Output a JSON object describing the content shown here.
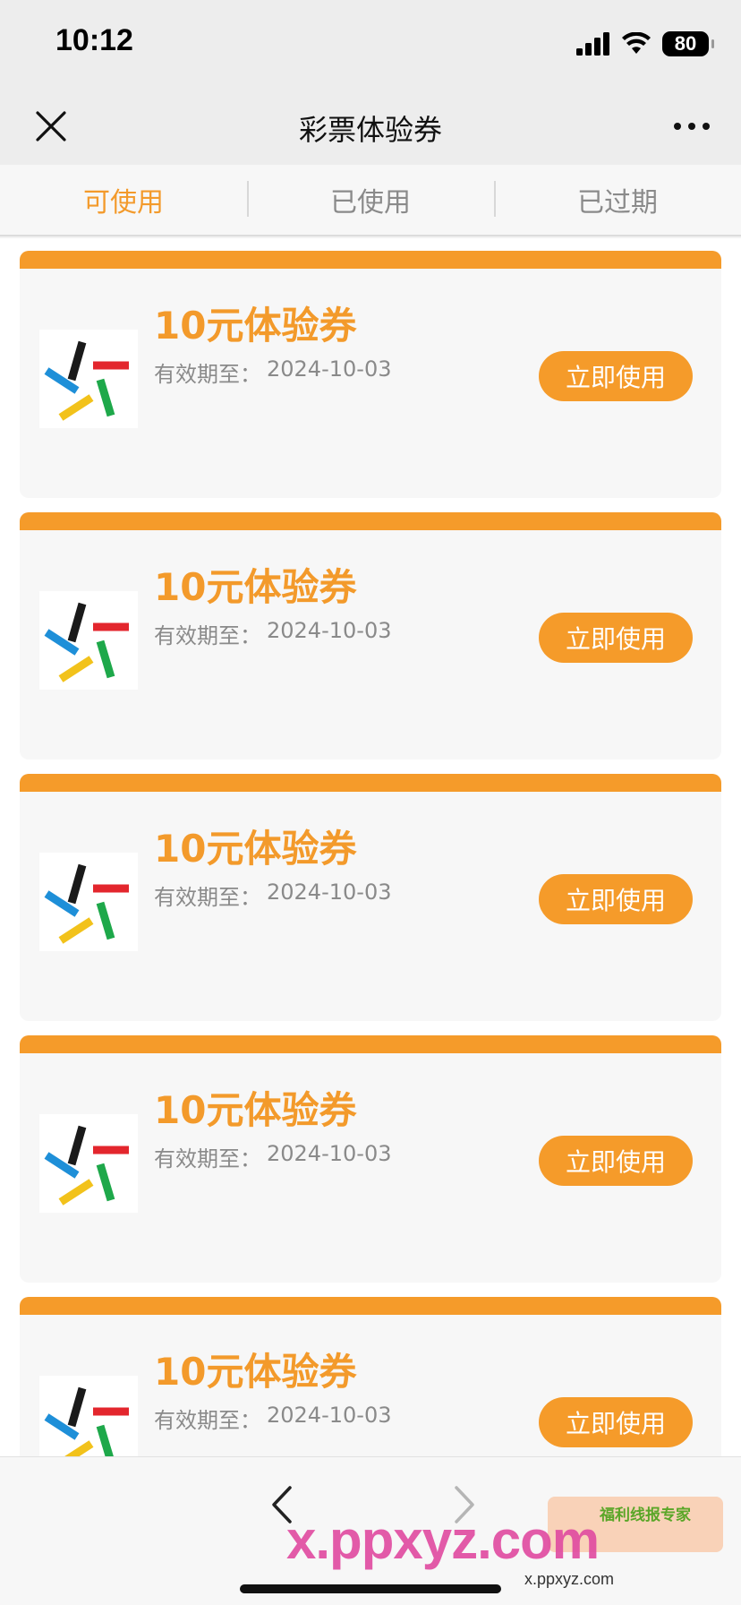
{
  "status": {
    "time": "10:12",
    "battery": "80"
  },
  "nav": {
    "title": "彩票体验券"
  },
  "tabs": [
    {
      "label": "可使用",
      "active": true
    },
    {
      "label": "已使用",
      "active": false
    },
    {
      "label": "已过期",
      "active": false
    }
  ],
  "coupons": [
    {
      "title": "10元体验券",
      "expiry_label": "有效期至：",
      "expiry_date": "2024-10-03",
      "button": "立即使用"
    },
    {
      "title": "10元体验券",
      "expiry_label": "有效期至：",
      "expiry_date": "2024-10-03",
      "button": "立即使用"
    },
    {
      "title": "10元体验券",
      "expiry_label": "有效期至：",
      "expiry_date": "2024-10-03",
      "button": "立即使用"
    },
    {
      "title": "10元体验券",
      "expiry_label": "有效期至：",
      "expiry_date": "2024-10-03",
      "button": "立即使用"
    },
    {
      "title": "10元体验券",
      "expiry_label": "有效期至：",
      "expiry_date": "2024-10-03",
      "button": "立即使用"
    }
  ],
  "watermark": {
    "text": "x.ppxyz.com",
    "sub": "x.ppxyz.com",
    "badge": "福利线报专家"
  },
  "colors": {
    "accent": "#f59b2a",
    "tab_active": "#f39a2b",
    "logo_black": "#1a1a1a",
    "logo_red": "#e3262d",
    "logo_blue": "#1e8fd8",
    "logo_yellow": "#f2c21b",
    "logo_green": "#1ea84a"
  },
  "icons": {
    "close": "close-icon",
    "more": "more-icon",
    "back": "chevron-left-icon",
    "forward": "chevron-right-icon",
    "logo": "lottery-logo-icon"
  }
}
